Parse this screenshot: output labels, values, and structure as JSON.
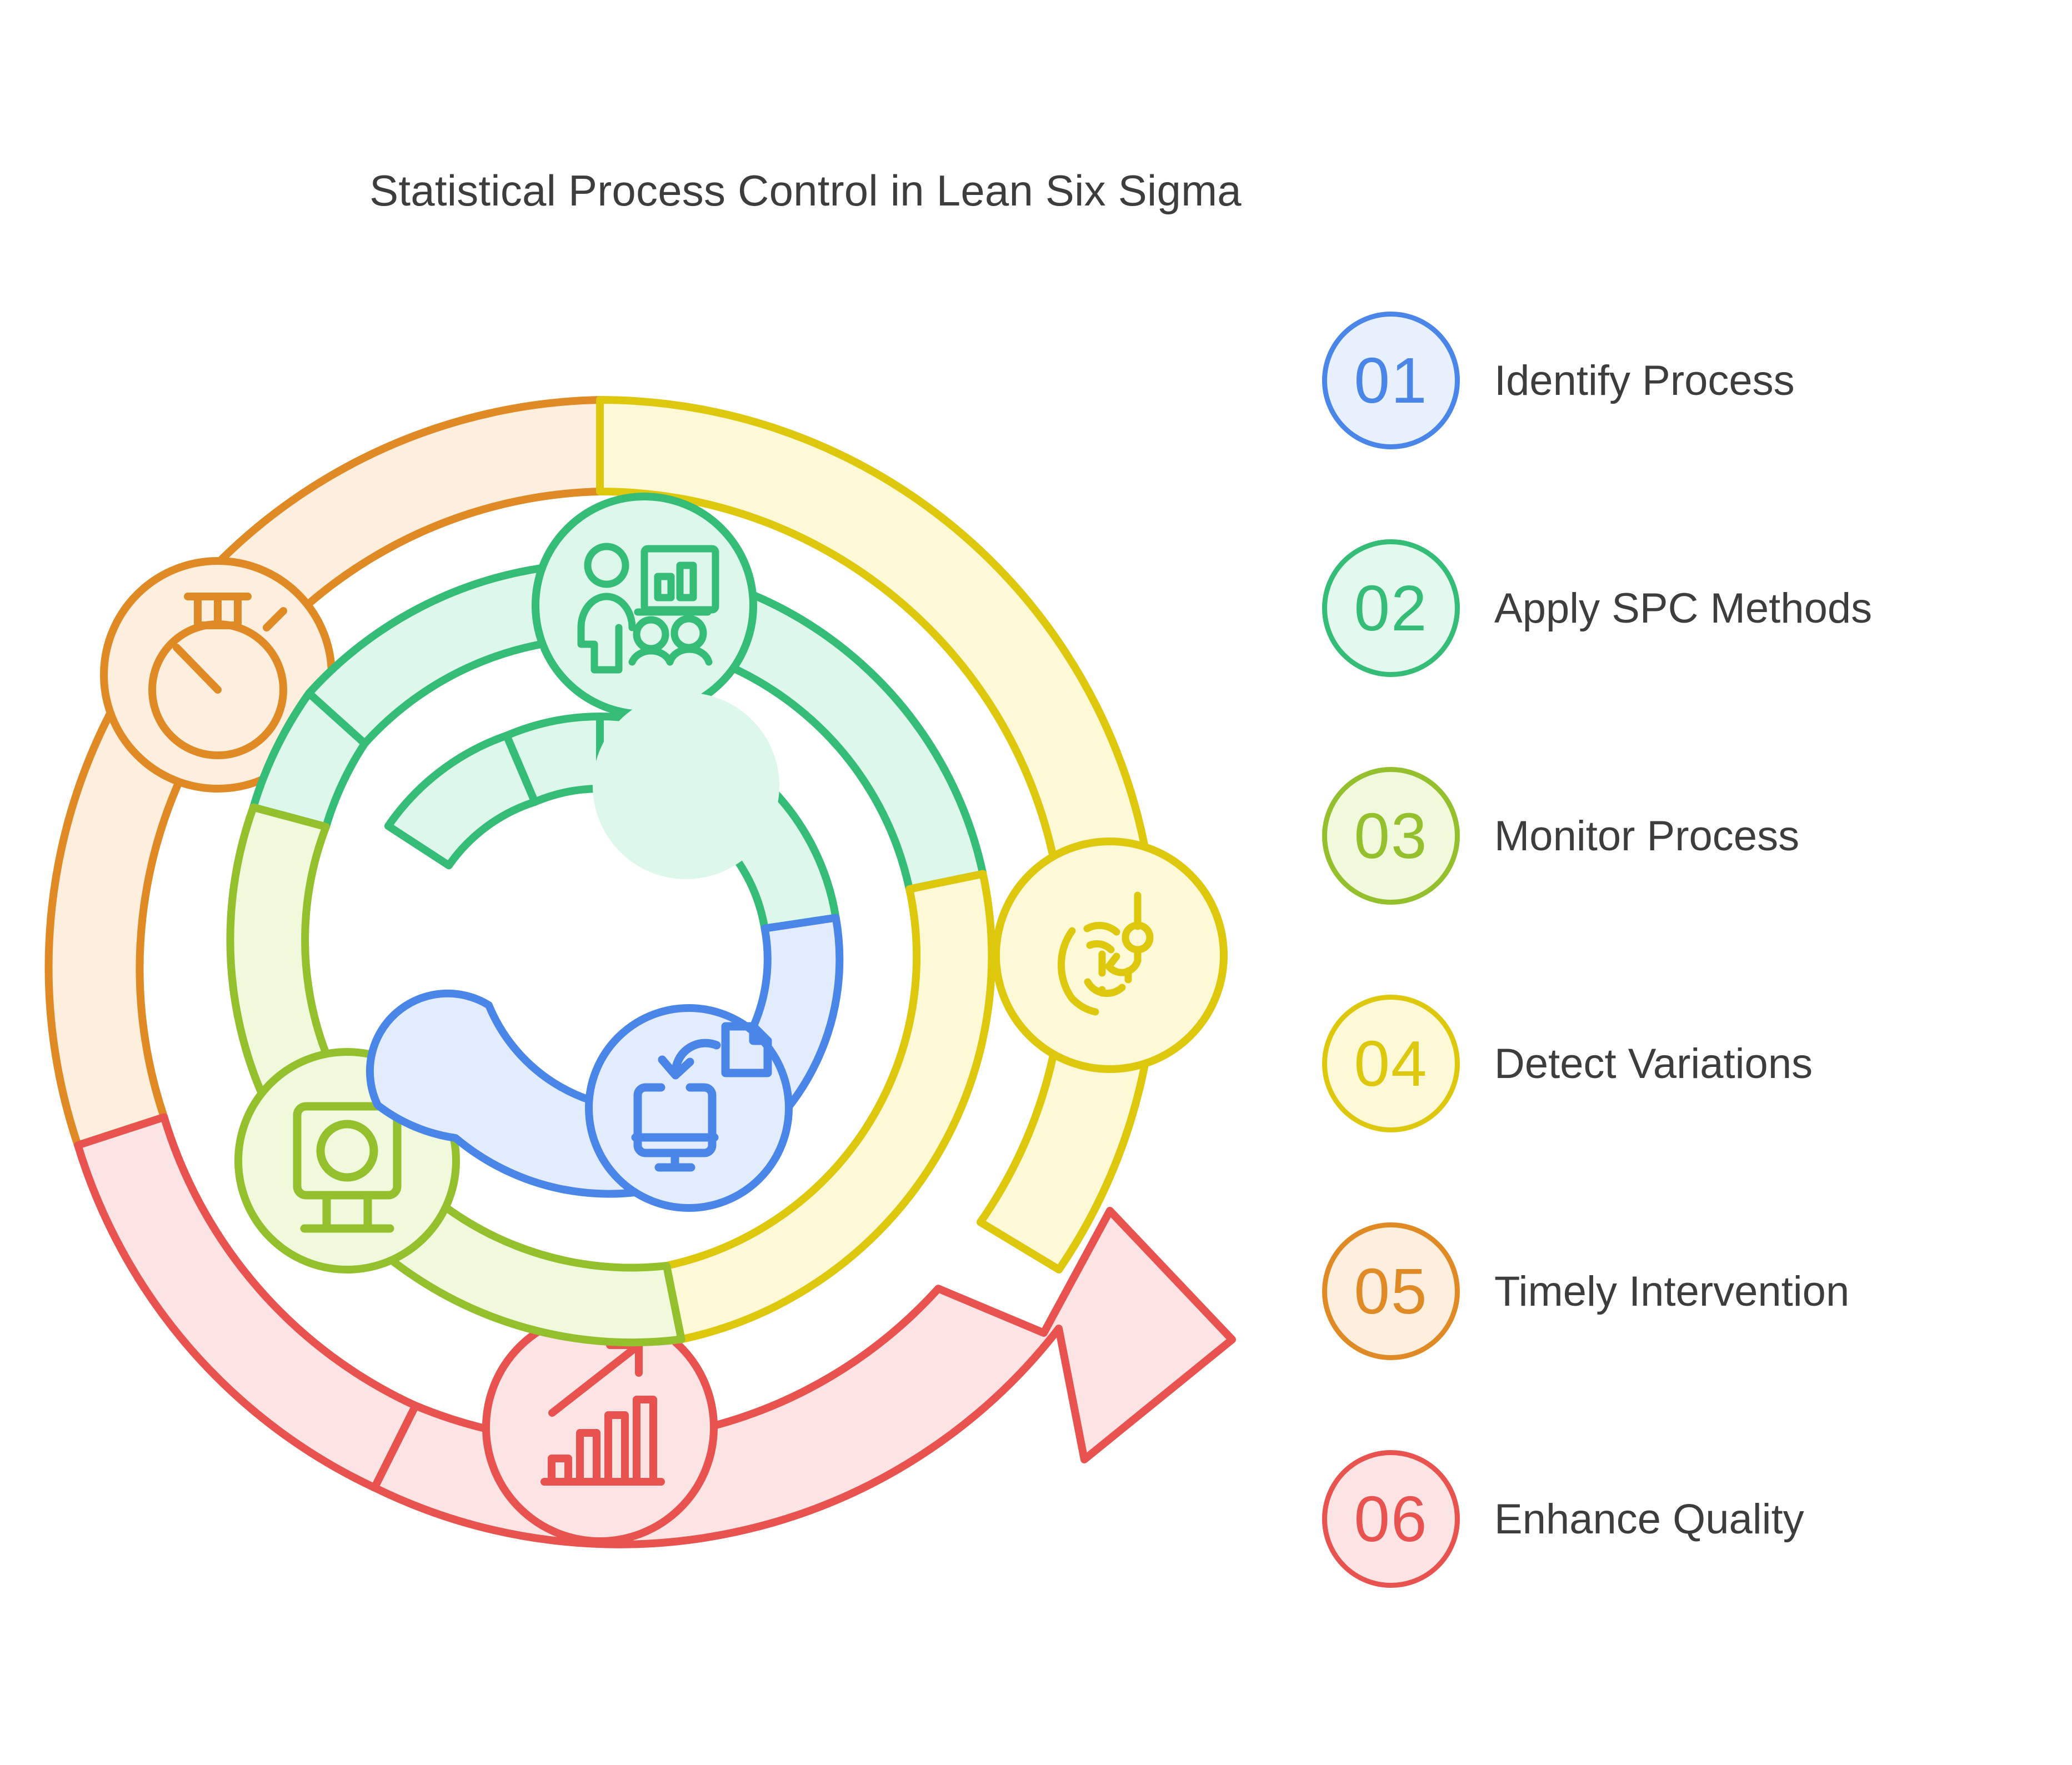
{
  "title": "Statistical Process Control in Lean Six Sigma",
  "legend": {
    "items": [
      {
        "number": "01",
        "label": "Identify Process",
        "stroke": "#4a86e8",
        "fill": "#e8f0fe",
        "icon": "monitor-download-icon"
      },
      {
        "number": "02",
        "label": "Apply SPC Methods",
        "stroke": "#35bd78",
        "fill": "#e3f9ed",
        "icon": "presentation-team-icon"
      },
      {
        "number": "03",
        "label": "Monitor Process",
        "stroke": "#94c02e",
        "fill": "#f1f9dc",
        "icon": "monitor-stand-icon"
      },
      {
        "number": "04",
        "label": "Detect Variations",
        "stroke": "#ddc80d",
        "fill": "#fdf8d6",
        "icon": "fingerprint-hook-icon"
      },
      {
        "number": "05",
        "label": "Timely Intervention",
        "stroke": "#e08a25",
        "fill": "#fdeedd",
        "icon": "stopwatch-icon"
      },
      {
        "number": "06",
        "label": "Enhance Quality",
        "stroke": "#e8524f",
        "fill": "#fde4e4",
        "icon": "growth-chart-icon"
      }
    ]
  },
  "diagram": {
    "type": "concentric-cycle",
    "rings": [
      {
        "name": "outer-ring",
        "segments": [
          {
            "step": "05",
            "label": "Timely Intervention",
            "stroke": "#e08a25",
            "fill": "#fdeedd",
            "icon": "stopwatch-icon",
            "start_deg": 200,
            "end_deg": 347
          },
          {
            "step": "04",
            "label": "Detect Variations",
            "stroke": "#ddc80d",
            "fill": "#fdf8d6",
            "icon": "fingerprint-hook-icon",
            "start_deg": 347,
            "end_deg": 100
          },
          {
            "step": "06",
            "label": "Enhance Quality",
            "stroke": "#e8524f",
            "fill": "#fde4e4",
            "icon": "growth-chart-icon",
            "start_deg": 100,
            "end_deg": 200
          }
        ]
      },
      {
        "name": "middle-ring",
        "segments": [
          {
            "step": "02",
            "label": "Apply SPC Methods",
            "stroke": "#35bd78",
            "fill": "#ddf8ea",
            "icon": "presentation-team-icon",
            "start_deg": 222,
            "end_deg": 12
          },
          {
            "step": "04",
            "label": "Detect Variations",
            "stroke": "#ddc80d",
            "fill": "#fdf8d6",
            "start_deg": 12,
            "end_deg": 78
          },
          {
            "step": "03",
            "label": "Monitor Process",
            "stroke": "#94c02e",
            "fill": "#f1f9dc",
            "icon": "monitor-stand-icon",
            "start_deg": 78,
            "end_deg": 222
          }
        ]
      },
      {
        "name": "inner-ring",
        "segments": [
          {
            "step": "02",
            "label": "Apply SPC Methods",
            "stroke": "#35bd78",
            "fill": "#ddf8ea",
            "icon": "presentation-team-icon",
            "start_deg": 247,
            "end_deg": 9
          },
          {
            "step": "01",
            "label": "Identify Process",
            "stroke": "#4a86e8",
            "fill": "#e2ecfd",
            "icon": "monitor-download-icon",
            "start_deg": 9,
            "end_deg": 180
          }
        ]
      }
    ],
    "arrow": {
      "stroke": "#e8524f",
      "fill": "#fde4e4",
      "direction": "clockwise-up-right"
    }
  }
}
